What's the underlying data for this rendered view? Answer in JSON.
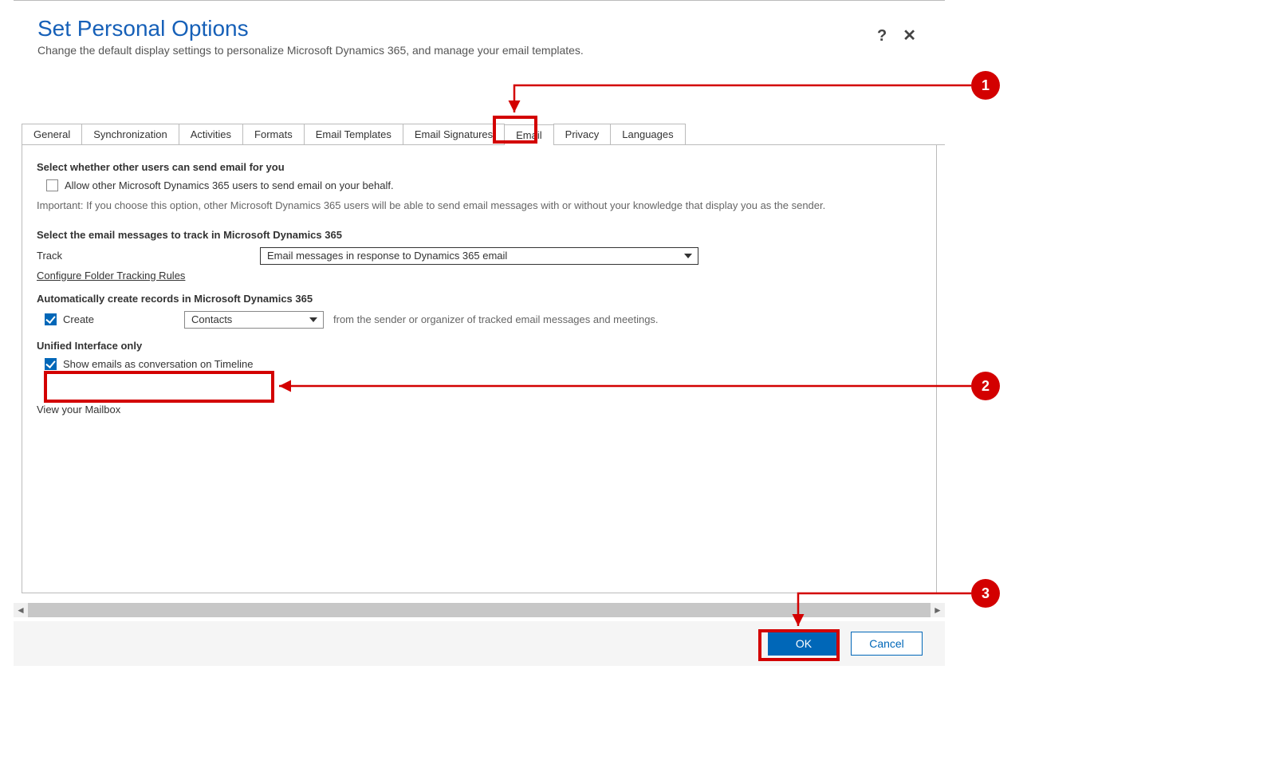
{
  "header": {
    "title": "Set Personal Options",
    "subtitle": "Change the default display settings to personalize Microsoft Dynamics 365, and manage your email templates.",
    "help_label": "?",
    "close_label": "✕"
  },
  "tabs": [
    {
      "id": "general",
      "label": "General"
    },
    {
      "id": "synchronization",
      "label": "Synchronization"
    },
    {
      "id": "activities",
      "label": "Activities"
    },
    {
      "id": "formats",
      "label": "Formats"
    },
    {
      "id": "emailtemplates",
      "label": "Email Templates"
    },
    {
      "id": "emailsignatures",
      "label": "Email Signatures"
    },
    {
      "id": "email",
      "label": "Email"
    },
    {
      "id": "privacy",
      "label": "Privacy"
    },
    {
      "id": "languages",
      "label": "Languages"
    }
  ],
  "email_panel": {
    "send_for_you_title": "Select whether other users can send email for you",
    "allow_others_label": "Allow other Microsoft Dynamics 365 users to send email on your behalf.",
    "allow_others_checked": false,
    "important_note": "Important: If you choose this option, other Microsoft Dynamics 365 users will be able to send email messages with or without your knowledge that display you as the sender.",
    "track_title": "Select the email messages to track in Microsoft Dynamics 365",
    "track_label": "Track",
    "track_value": "Email messages in response to Dynamics 365 email",
    "config_link": "Configure Folder Tracking Rules",
    "auto_create_title": "Automatically create records in Microsoft Dynamics 365",
    "create_checked": true,
    "create_label": "Create",
    "create_value": "Contacts",
    "create_suffix": "from the sender or organizer of tracked email messages and meetings.",
    "ui_only_title": "Unified Interface only",
    "show_conv_checked": true,
    "show_conv_label": "Show emails as conversation on Timeline",
    "view_mailbox": "View your Mailbox"
  },
  "footer": {
    "ok": "OK",
    "cancel": "Cancel"
  },
  "callouts": {
    "c1": "1",
    "c2": "2",
    "c3": "3"
  }
}
